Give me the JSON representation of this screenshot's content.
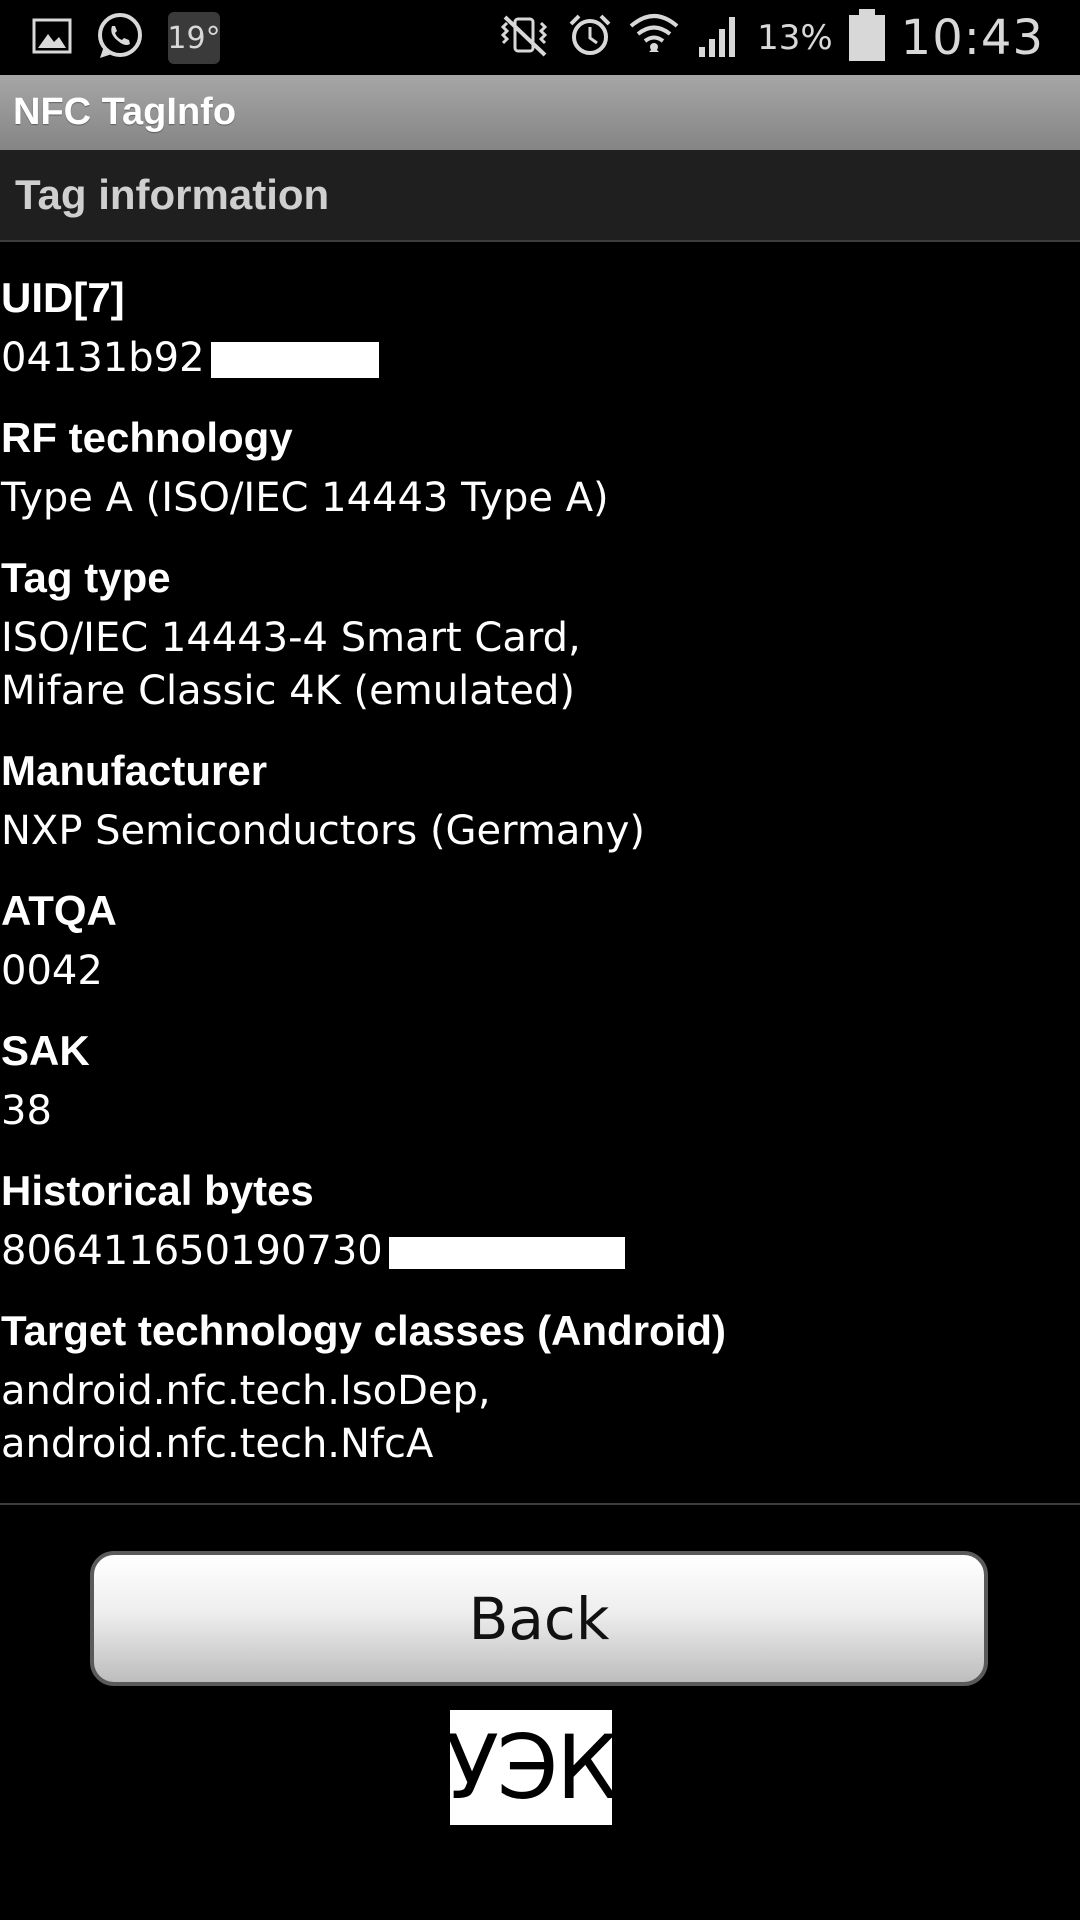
{
  "status_bar": {
    "icons": [
      "gallery-icon",
      "whatsapp-icon",
      "weather-temp-icon",
      "vibrate-mute-icon",
      "alarm-icon",
      "wifi-icon",
      "signal-icon",
      "battery-icon"
    ],
    "temperature": "19°",
    "battery_percent": "13%",
    "time": "10:43"
  },
  "app": {
    "title": "NFC TagInfo"
  },
  "section": {
    "title": "Tag information"
  },
  "fields": [
    {
      "label": "UID[7]",
      "value_lines": [
        "04131b92"
      ],
      "redacted": true
    },
    {
      "label": "RF technology",
      "value_lines": [
        "Type A (ISO/IEC 14443 Type A)"
      ]
    },
    {
      "label": "Tag type",
      "value_lines": [
        "ISO/IEC 14443-4 Smart Card,",
        "Mifare Classic 4K (emulated)"
      ]
    },
    {
      "label": "Manufacturer",
      "value_lines": [
        "NXP Semiconductors (Germany)"
      ]
    },
    {
      "label": "ATQA",
      "value_lines": [
        "0042"
      ]
    },
    {
      "label": "SAK",
      "value_lines": [
        "38"
      ]
    },
    {
      "label": "Historical bytes",
      "value_lines": [
        "806411650190730"
      ],
      "redacted": true
    },
    {
      "label": "Target technology classes (Android)",
      "value_lines": [
        "android.nfc.tech.IsoDep,",
        "android.nfc.tech.NfcA"
      ]
    }
  ],
  "back_button": {
    "label": "Back"
  },
  "watermark": {
    "text": "УЭК"
  },
  "colors": {
    "background": "#000000",
    "title_bar": "#999999",
    "section_header": "#1f1f1f",
    "text": "#ffffff"
  }
}
